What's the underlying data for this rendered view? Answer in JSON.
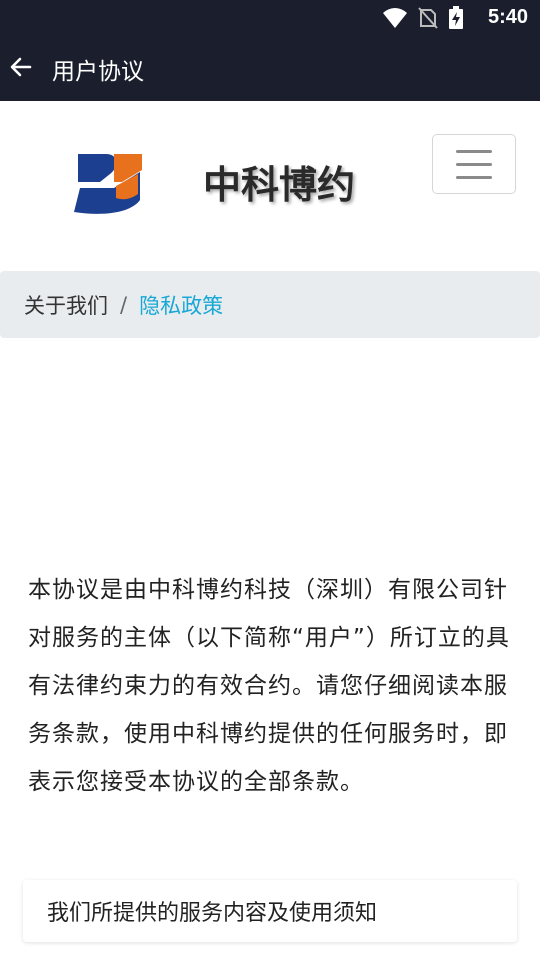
{
  "status_bar": {
    "time": "5:40",
    "icons": [
      "wifi-icon",
      "no-sim-icon",
      "battery-charging-icon"
    ]
  },
  "app_bar": {
    "title": "用户协议",
    "back_icon": "arrow-left-icon"
  },
  "brand": {
    "name": "中科博约",
    "menu_icon": "hamburger-menu-icon"
  },
  "breadcrumb": {
    "home": "关于我们",
    "separator": "/",
    "current": "隐私政策"
  },
  "content": {
    "intro": "本协议是由中科博约科技（深圳）有限公司针对服务的主体（以下简称“用户”）所订立的具有法律约束力的有效合约。请您仔细阅读本服务条款，使用中科博约提供的任何服务时，即表示您接受本协议的全部条款。"
  },
  "section_card": {
    "title": "我们所提供的服务内容及使用须知"
  },
  "colors": {
    "top_bar": "#1b1f2d",
    "breadcrumb_bg": "#e9ecef",
    "breadcrumb_active": "#17a8d6",
    "logo_blue": "#1c3f8f",
    "logo_orange": "#e8711e"
  }
}
